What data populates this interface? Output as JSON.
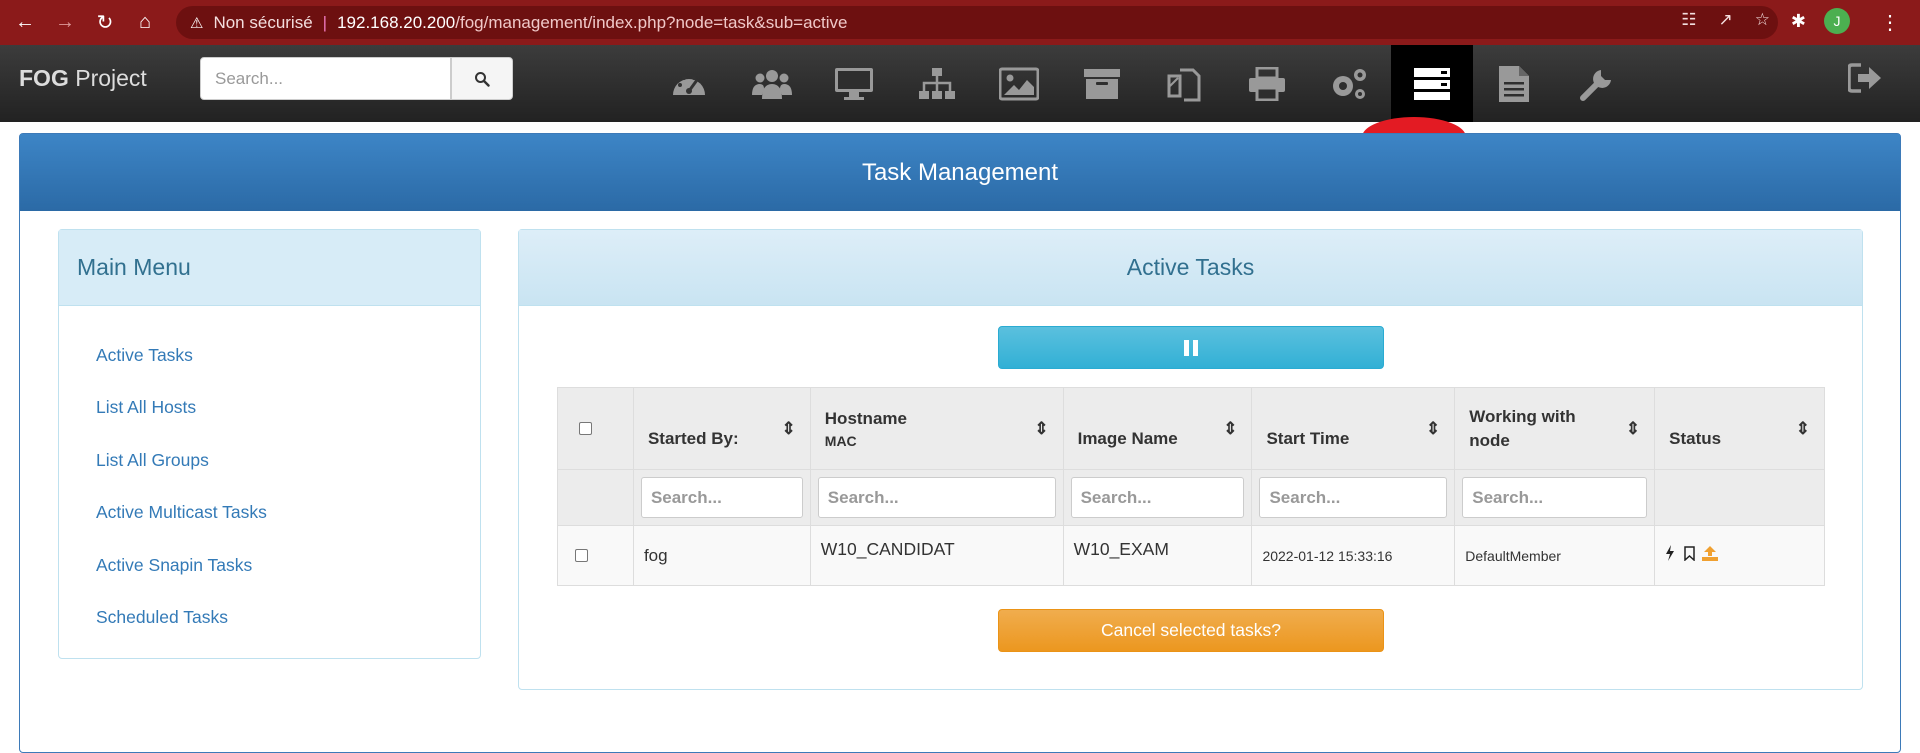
{
  "browser": {
    "security_label": "Non sécurisé",
    "url_host": "192.168.20.200",
    "url_path": "/fog/management/index.php?node=task&sub=active",
    "profile_initial": "J"
  },
  "navbar": {
    "brand_bold": "FOG",
    "brand_rest": " Project",
    "search_placeholder": "Search...",
    "icons": [
      "dashboard-icon",
      "users-icon",
      "monitor-icon",
      "sitemap-icon",
      "image-icon",
      "archive-icon",
      "copy-icon",
      "print-icon",
      "settings-icon",
      "tasks-icon",
      "report-icon",
      "wrench-icon"
    ],
    "active_icon": "tasks-icon"
  },
  "page": {
    "title": "Task Management"
  },
  "sidebar": {
    "title": "Main Menu",
    "items": [
      {
        "label": "Active Tasks"
      },
      {
        "label": "List All Hosts"
      },
      {
        "label": "List All Groups"
      },
      {
        "label": "Active Multicast Tasks"
      },
      {
        "label": "Active Snapin Tasks"
      },
      {
        "label": "Scheduled Tasks"
      }
    ]
  },
  "content": {
    "title": "Active Tasks",
    "table": {
      "columns": [
        {
          "label": "Started By:"
        },
        {
          "label": "Hostname",
          "sub": "MAC"
        },
        {
          "label": "Image Name"
        },
        {
          "label": "Start Time"
        },
        {
          "label": "Working with node"
        },
        {
          "label": "Status"
        }
      ],
      "filter_placeholder": "Search...",
      "rows": [
        {
          "started_by": "fog",
          "hostname": "W10_CANDIDAT",
          "image_name": "W10_EXAM",
          "start_time": "2022-01-12 15:33:16",
          "node": "DefaultMember",
          "status_icons": [
            "bolt-icon",
            "bookmark-icon",
            "upload-icon"
          ]
        }
      ]
    },
    "cancel_label": "Cancel selected tasks?"
  },
  "colors": {
    "accent": "#337ab7",
    "info": "#5bc0de",
    "warning": "#f0ad4e",
    "browser_bar": "#8b1a1a"
  }
}
